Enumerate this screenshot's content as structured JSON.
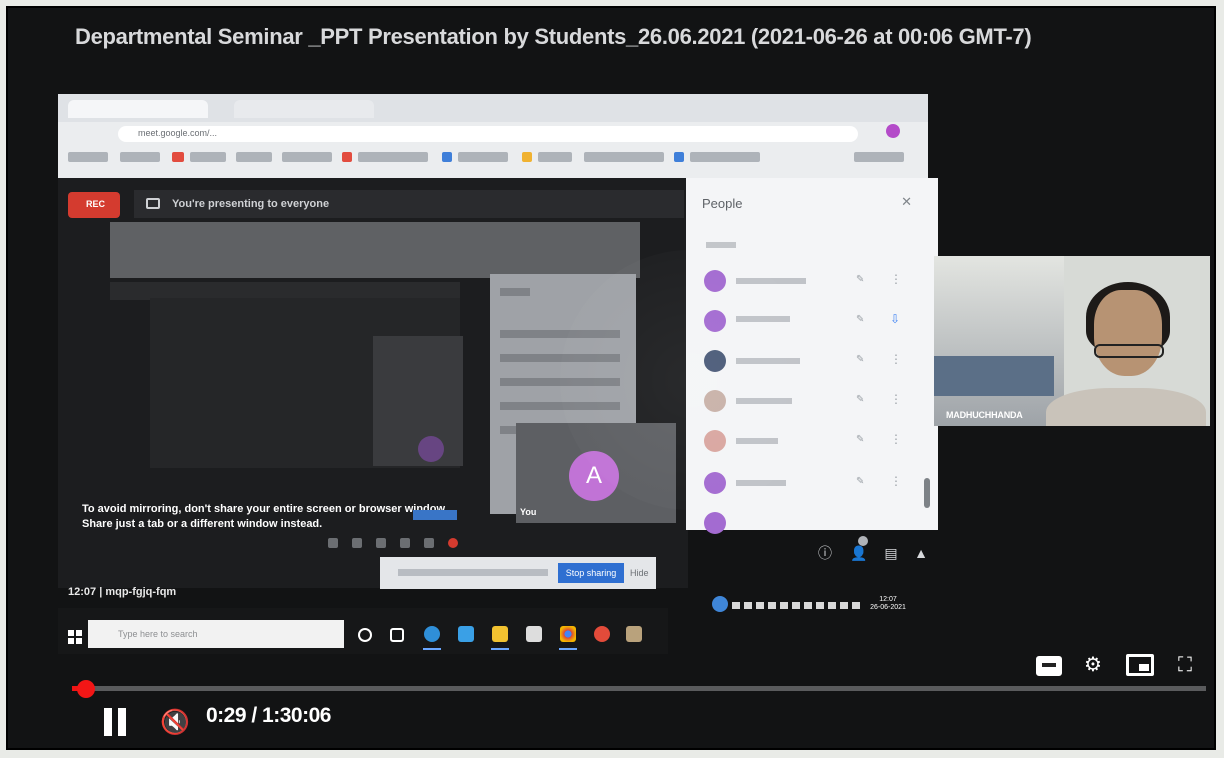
{
  "video": {
    "title": "Departmental Seminar _PPT Presentation by Students_26.06.2021 (2021-06-26 at 00:06 GMT-7)",
    "current_time": "0:29",
    "duration": "1:30:06",
    "progress_fraction": 0.0003
  },
  "meet": {
    "rec_label": "REC",
    "presenting_text": "You're presenting to everyone",
    "avatar_letter": "A",
    "self_label": "You",
    "mirror_warning": "To avoid mirroring, don't share your entire screen or browser window. Share just a tab or a different window instead.",
    "meeting_code": "12:07  |  mqp-fgjq-fqm",
    "stop_sharing_label": "Stop sharing",
    "hide_label": "Hide"
  },
  "people_panel": {
    "title": "People",
    "close_icon": "close-icon"
  },
  "webcam": {
    "participant_name": "MADHUCHHANDA"
  },
  "taskbar": {
    "search_placeholder": "Type here to search",
    "clock_time": "12:07",
    "clock_date": "26-06-2021"
  },
  "colors": {
    "progress": "#f01414",
    "stop_button": "#2f6fd1",
    "rec": "#d43b2f",
    "avatar": "#c173d6"
  }
}
